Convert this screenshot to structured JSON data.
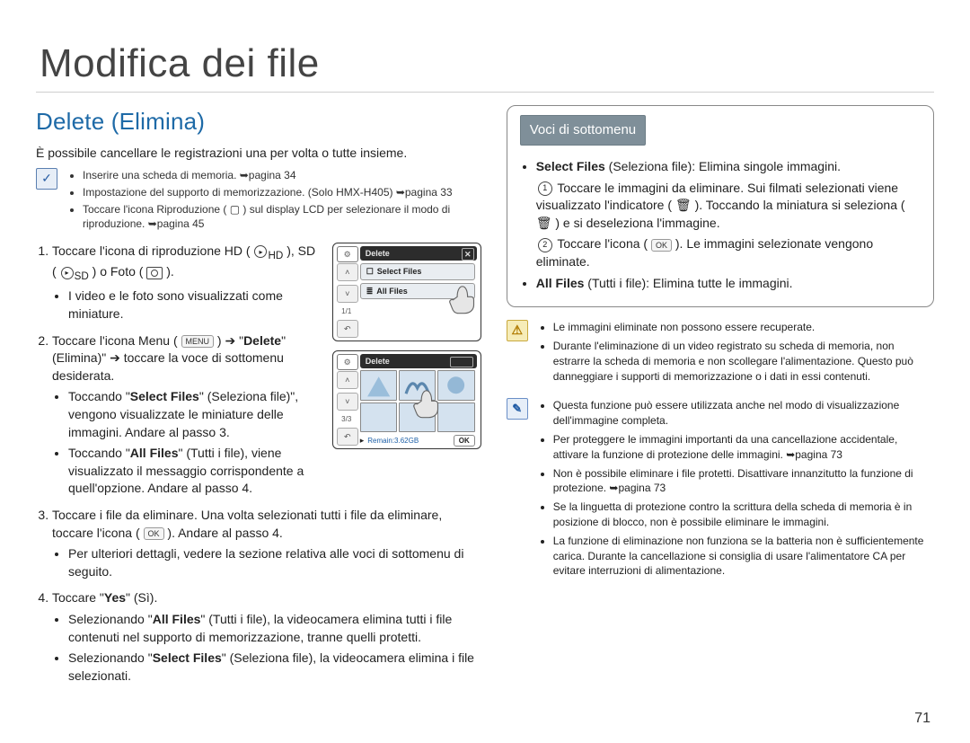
{
  "page_number": "71",
  "title": "Modifica dei file",
  "left": {
    "section_title": "Delete (Elimina)",
    "intro": "È possibile cancellare le registrazioni una per volta o tutte insieme.",
    "prereq": [
      "Inserire una scheda di memoria. ➥pagina 34",
      "Impostazione del supporto di memorizzazione. (Solo HMX-H405) ➥pagina 33",
      "Toccare l'icona Riproduzione ( ▢ ) sul display LCD per selezionare il modo di riproduzione. ➥pagina 45"
    ],
    "step1": {
      "lead": "Toccare l'icona di riproduzione HD (",
      "hd": "HD",
      "mid1": " ), SD (",
      "sd": "SD",
      "mid2": " ) o Foto (",
      "end": " ).",
      "sub": "I video e le foto sono visualizzati come miniature."
    },
    "step2": {
      "lead": "Toccare l'icona Menu (",
      "menu_pill": "MENU",
      "mid": " ) ➔ \"",
      "delete_label": "Delete",
      "after_delete": "\" (Elimina)\" ➔ toccare la voce di sottomenu desiderata.",
      "sub1_prefix": "Toccando \"",
      "sub1_bold": "Select Files",
      "sub1_rest": "\" (Seleziona file)\", vengono visualizzate le miniature delle immagini. Andare al passo 3.",
      "sub2_prefix": "Toccando \"",
      "sub2_bold": "All Files",
      "sub2_rest": "\" (Tutti i file), viene visualizzato il messaggio corrispondente a quell'opzione. Andare al passo 4."
    },
    "step3": {
      "lead": "Toccare i file da eliminare. Una volta selezionati tutti i file da eliminare, toccare l'icona (",
      "ok_pill": "OK",
      "rest": " ). Andare al passo 4.",
      "sub": "Per ulteriori dettagli, vedere la sezione relativa alle voci di sottomenu di seguito."
    },
    "step4": {
      "lead": "Toccare \"",
      "yes": "Yes",
      "after": "\" (Sì).",
      "sub1_prefix": "Selezionando \"",
      "sub1_bold": "All Files",
      "sub1_rest": "\" (Tutti i file), la videocamera elimina tutti i file contenuti nel supporto di memorizzazione, tranne quelli protetti.",
      "sub2_prefix": "Selezionando \"",
      "sub2_bold": "Select Files",
      "sub2_rest": "\" (Seleziona file), la videocamera elimina i file selezionati."
    },
    "screen1": {
      "title": "Delete",
      "opt1": "Select Files",
      "opt2": "All Files",
      "page_indicator": "1/1"
    },
    "screen2": {
      "title": "Delete",
      "counter": "3/3",
      "remain": "Remain:3.62GB",
      "ok": "OK"
    }
  },
  "right": {
    "badge": "Voci di sottomenu",
    "item1_bold": "Select Files",
    "item1_rest": " (Seleziona file): Elimina singole immagini.",
    "item1_a": "Toccare le immagini da eliminare. Sui filmati selezionati viene visualizzato l'indicatore ( 🗑 ). Toccando la miniatura si seleziona ( 🗑 ) e si deseleziona l'immagine.",
    "item1_b_lead": "Toccare l'icona (",
    "item1_b_pill": "OK",
    "item1_b_rest": " ). Le immagini selezionate vengono eliminate.",
    "item2_bold": "All Files",
    "item2_rest": " (Tutti i file): Elimina tutte le immagini.",
    "warn": [
      "Le immagini eliminate non possono essere recuperate.",
      "Durante l'eliminazione di un video registrato su scheda di memoria, non estrarre la scheda di memoria e non scollegare l'alimentazione. Questo può danneggiare i supporti di memorizzazione o i dati in essi contenuti."
    ],
    "info": [
      "Questa funzione può essere utilizzata anche nel modo di visualizzazione dell'immagine completa.",
      "Per proteggere le immagini importanti da una cancellazione accidentale, attivare la funzione di protezione delle immagini. ➥pagina 73",
      "Non è possibile eliminare i file protetti. Disattivare innanzitutto la funzione di protezione. ➥pagina 73",
      "Se la linguetta di protezione contro la scrittura della scheda di memoria è in posizione di blocco, non è possibile eliminare le immagini.",
      "La funzione di eliminazione non funziona se la batteria non è sufficientemente carica. Durante la cancellazione si consiglia di usare l'alimentatore CA per evitare interruzioni di alimentazione."
    ]
  }
}
